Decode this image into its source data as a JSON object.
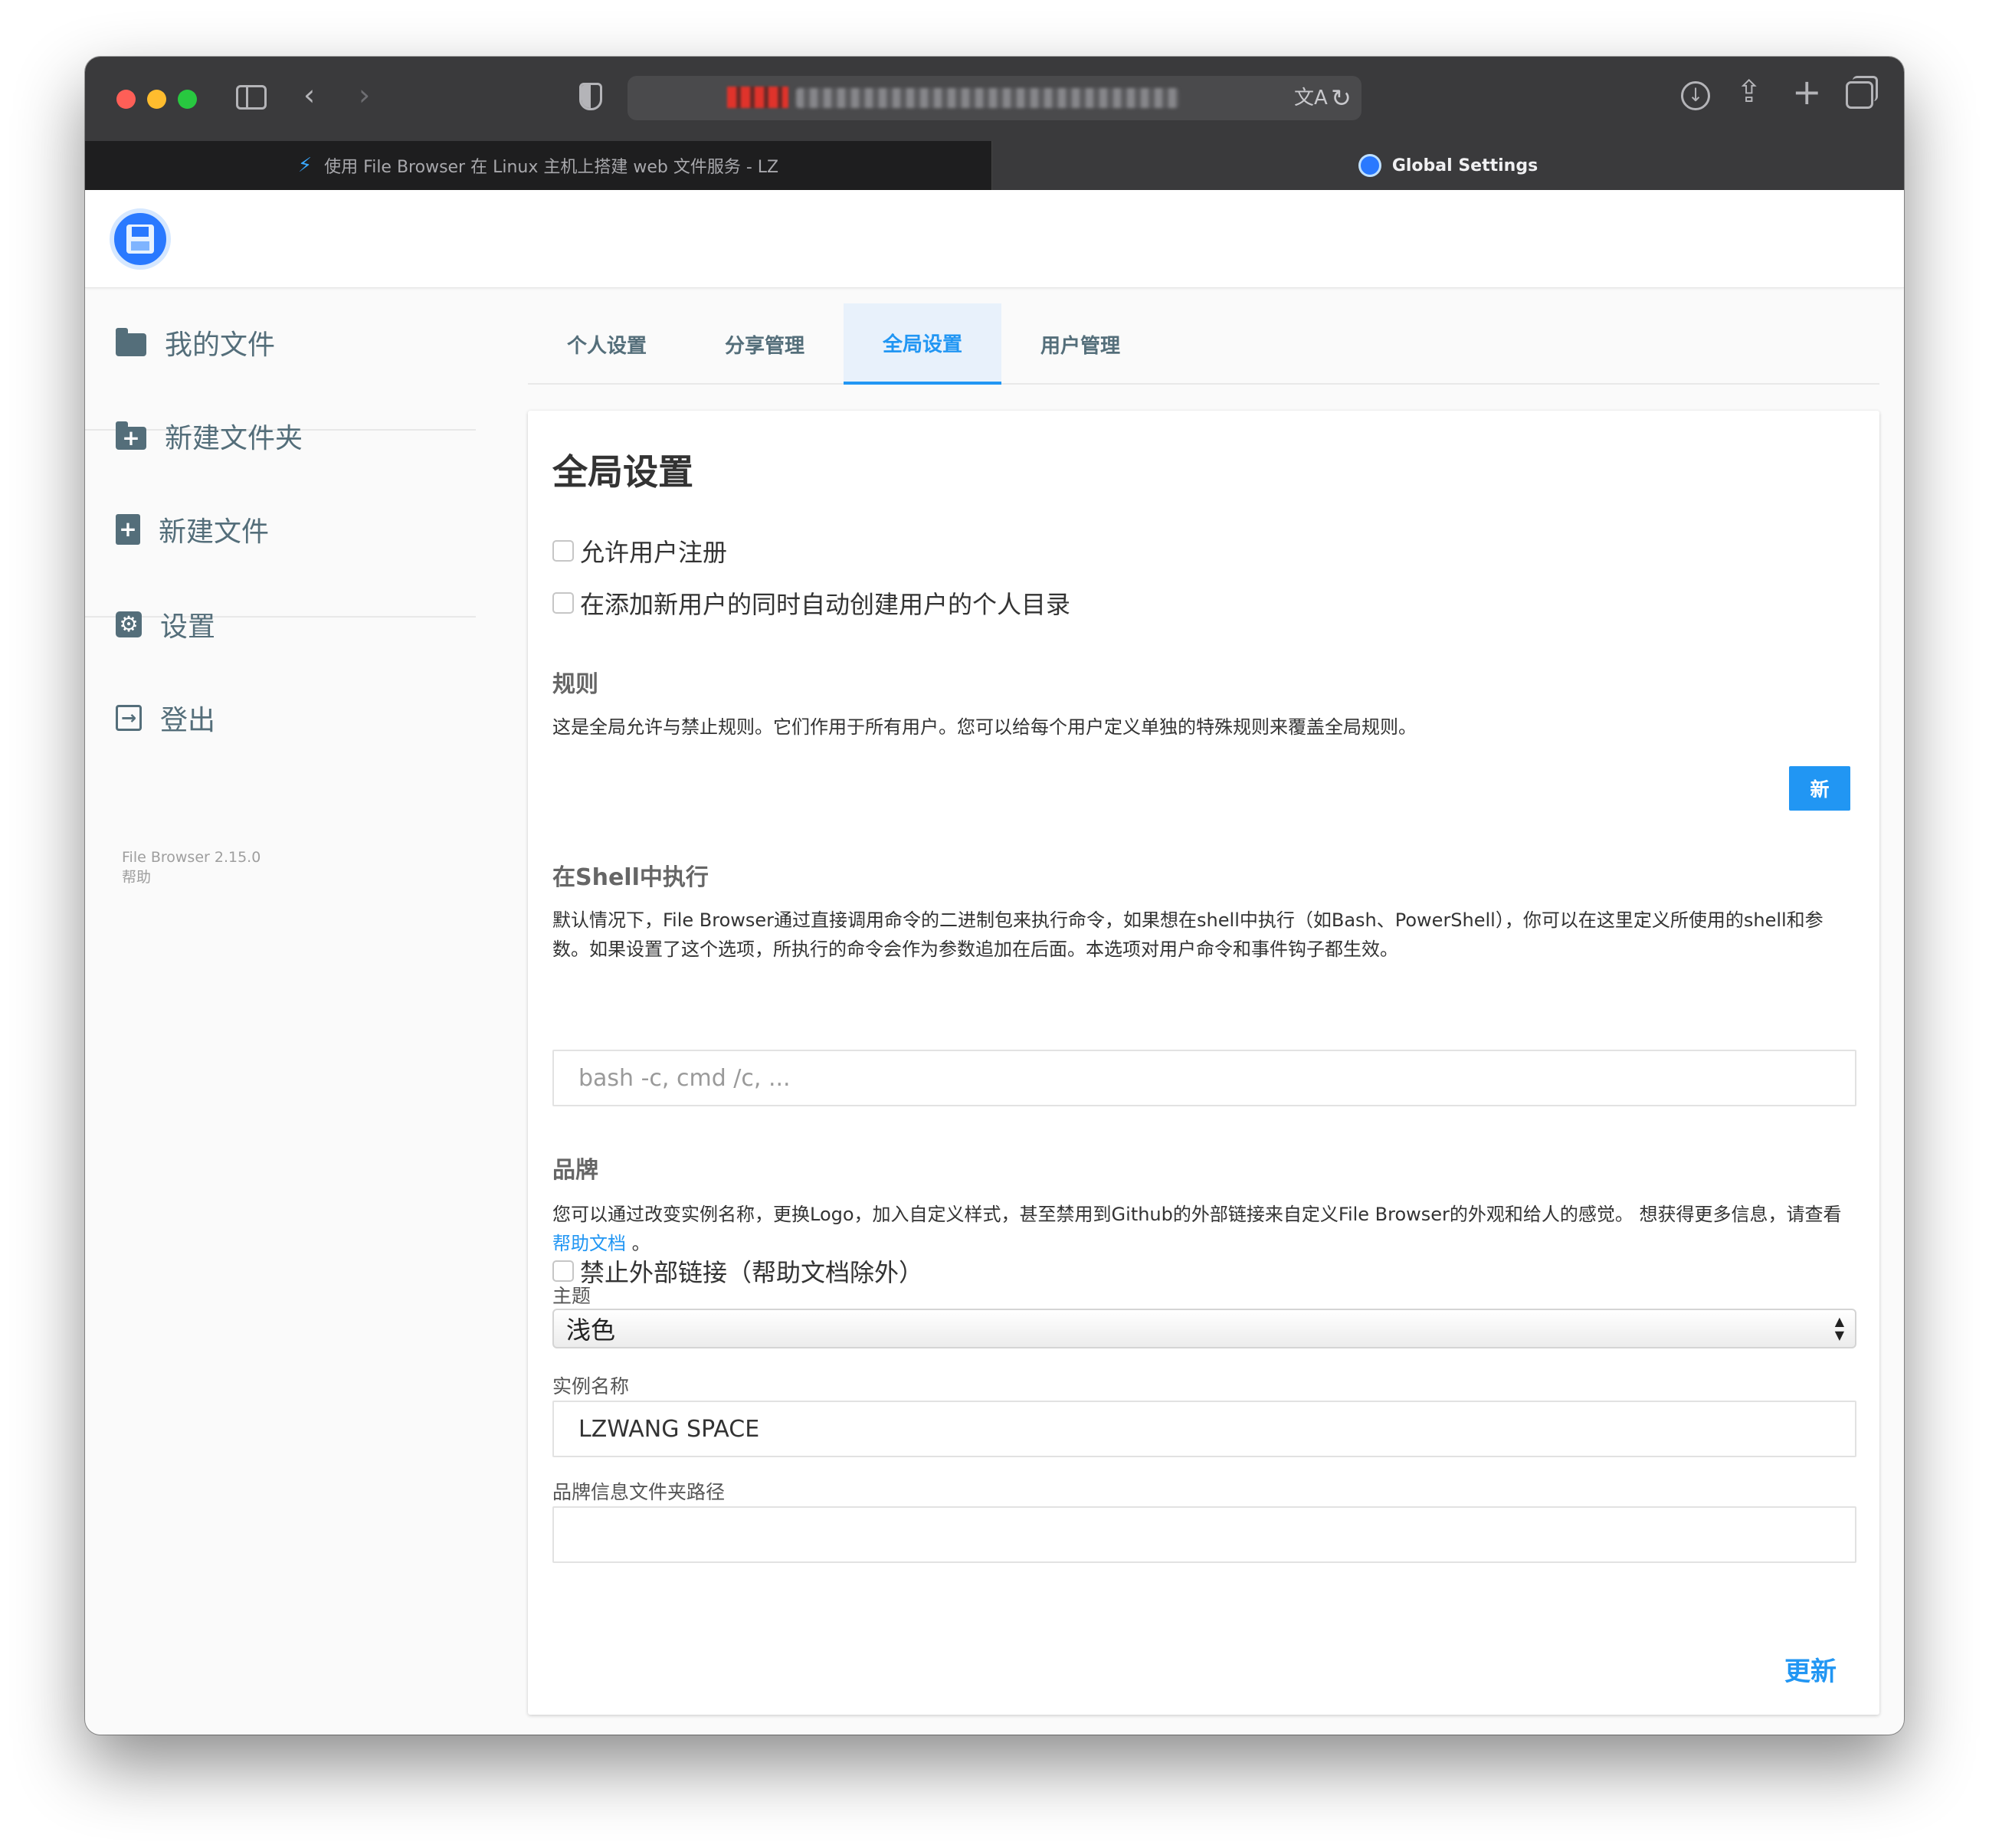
{
  "browser": {
    "tabs": [
      {
        "label": "使用 File Browser 在 Linux 主机上搭建 web 文件服务 - LZ"
      },
      {
        "label": "Global Settings"
      }
    ]
  },
  "sidebar": {
    "items": [
      {
        "label": "我的文件",
        "icon": "folder-icon"
      },
      {
        "label": "新建文件夹",
        "icon": "folder-add-icon"
      },
      {
        "label": "新建文件",
        "icon": "file-add-icon"
      },
      {
        "label": "设置",
        "icon": "gear-icon"
      },
      {
        "label": "登出",
        "icon": "logout-icon"
      }
    ],
    "version": "File Browser 2.15.0",
    "help": "帮助"
  },
  "settings_tabs": [
    {
      "label": "个人设置"
    },
    {
      "label": "分享管理"
    },
    {
      "label": "全局设置",
      "active": true
    },
    {
      "label": "用户管理"
    }
  ],
  "card": {
    "title": "全局设置",
    "allow_signup": {
      "label": "允许用户注册",
      "checked": false
    },
    "create_home": {
      "label": "在添加新用户的同时自动创建用户的个人目录",
      "checked": false
    },
    "rules": {
      "title": "规则",
      "description": "这是全局允许与禁止规则。它们作用于所有用户。您可以给每个用户定义单独的特殊规则来覆盖全局规则。",
      "new_button": "新"
    },
    "shell": {
      "title": "在Shell中执行",
      "description": "默认情况下，File Browser通过直接调用命令的二进制包来执行命令，如果想在shell中执行（如Bash、PowerShell），你可以在这里定义所使用的shell和参数。如果设置了这个选项，所执行的命令会作为参数追加在后面。本选项对用户命令和事件钩子都生效。",
      "placeholder": "bash -c, cmd /c, ..."
    },
    "branding": {
      "title": "品牌",
      "description_before": "您可以通过改变实例名称，更换Logo，加入自定义样式，甚至禁用到Github的外部链接来自定义File Browser的外观和给人的感觉。 想获得更多信息，请查看 ",
      "help_link": "帮助文档",
      "description_after": " 。",
      "disable_external": {
        "label": "禁止外部链接（帮助文档除外）",
        "checked": false
      },
      "theme_label": "主题",
      "theme_value": "浅色",
      "instance_name_label": "实例名称",
      "instance_name_value": "LZWANG SPACE",
      "branding_dir_label": "品牌信息文件夹路径",
      "branding_dir_value": ""
    },
    "update_button": "更新"
  },
  "colors": {
    "accent": "#2196f3",
    "sidebar_text": "#546e7a"
  }
}
